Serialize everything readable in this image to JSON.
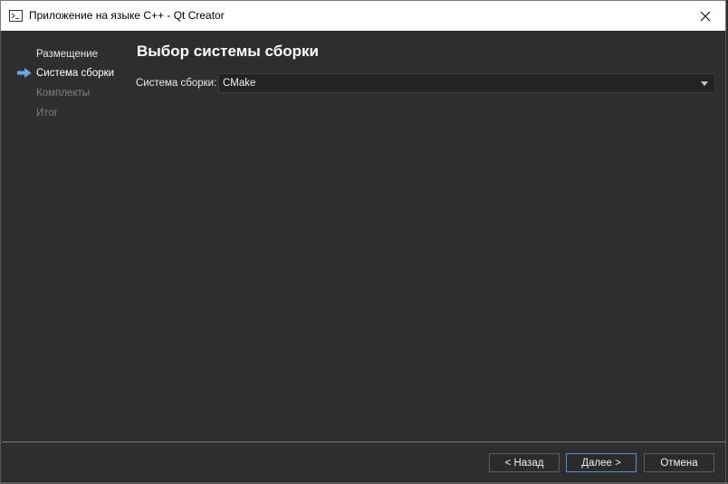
{
  "window": {
    "title": "Приложение на языке C++ - Qt Creator",
    "close_symbol": "✕"
  },
  "sidebar": {
    "steps": [
      {
        "label": "Размещение",
        "state": "done"
      },
      {
        "label": "Система сборки",
        "state": "current"
      },
      {
        "label": "Комплекты",
        "state": "pending"
      },
      {
        "label": "Итог",
        "state": "pending"
      }
    ],
    "current_indicator_icon": "arrow-right-icon"
  },
  "page": {
    "heading": "Выбор системы сборки",
    "build_system_label": "Система сборки:",
    "build_system_value": "CMake"
  },
  "buttons": {
    "back_label": "< Назад",
    "next_label": "Далее >",
    "cancel_label": "Отмена"
  },
  "colors": {
    "background": "#2e2e2e",
    "accent": "#5a8fd0",
    "arrow": "#6ea6e8"
  }
}
